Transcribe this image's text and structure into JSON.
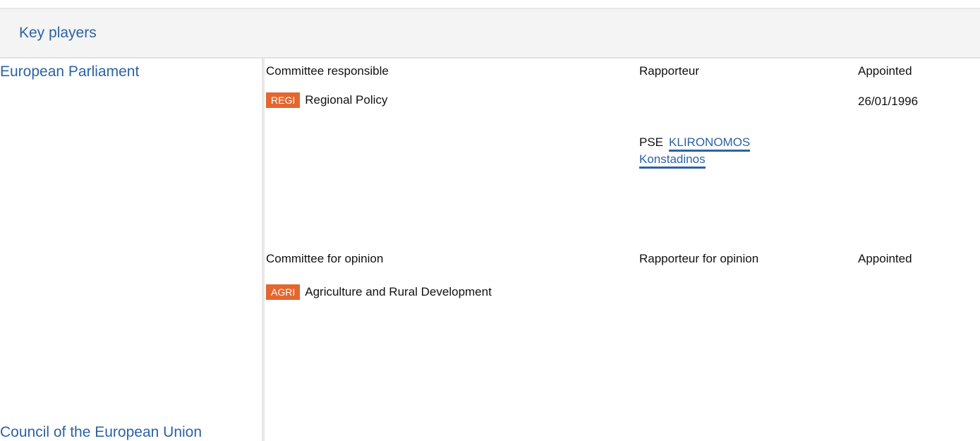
{
  "header": {
    "title": "Key players"
  },
  "sections": {
    "parliament_label": "European Parliament",
    "council_label": "Council of the European Union"
  },
  "responsible": {
    "col_committee": "Committee responsible",
    "col_rapporteur": "Rapporteur",
    "col_appointed": "Appointed",
    "committee_code": "REGI",
    "committee_name": "Regional Policy",
    "appointed_date": "26/01/1996",
    "rapporteur_party": "PSE",
    "rapporteur_name_line1": "KLIRONOMOS",
    "rapporteur_name_line2": "Konstadinos"
  },
  "opinion": {
    "col_committee": "Committee for opinion",
    "col_rapporteur": "Rapporteur for opinion",
    "col_appointed": "Appointed",
    "committee_code": "AGRI",
    "committee_name": "Agriculture and Rural Development"
  },
  "colors": {
    "link": "#2b63a3",
    "badge": "#e3672f",
    "header_bg": "#f4f4f4"
  }
}
